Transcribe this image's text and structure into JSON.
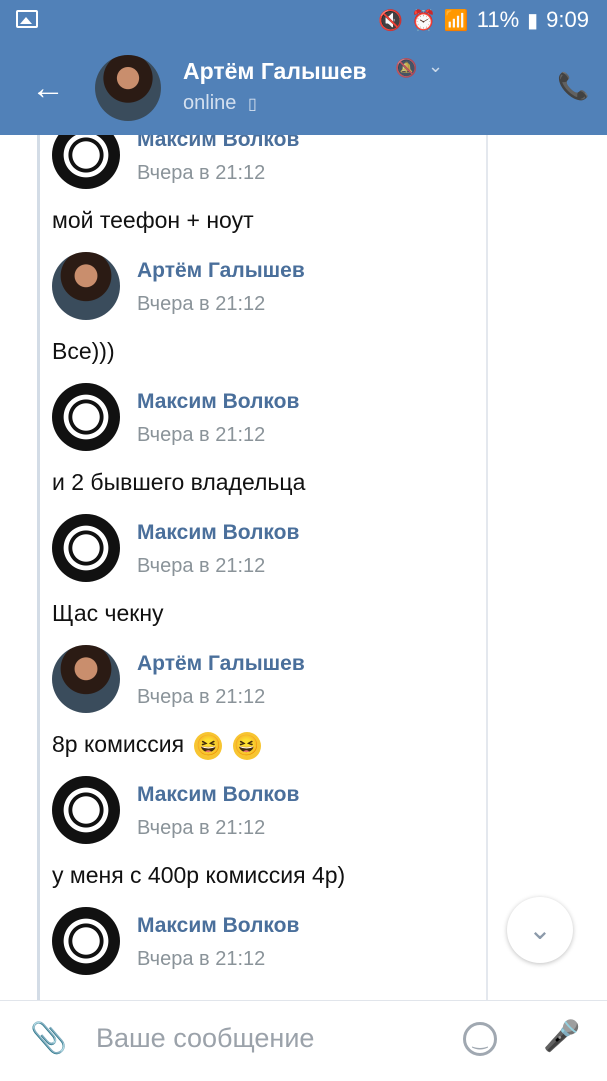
{
  "status_bar": {
    "battery": "11%",
    "time": "9:09"
  },
  "header": {
    "contact_name": "Артём Галышев",
    "presence": "online"
  },
  "messages": [
    {
      "author": "Максим Волков",
      "time": "Вчера в 21:12",
      "text": "мой теефон + ноут",
      "avatar": "maksim"
    },
    {
      "author": "Артём Галышев",
      "time": "Вчера в 21:12",
      "text": "Все)))",
      "avatar": "artem"
    },
    {
      "author": "Максим Волков",
      "time": "Вчера в 21:12",
      "text": "и 2 бывшего владельца",
      "avatar": "maksim"
    },
    {
      "author": "Максим Волков",
      "time": "Вчера в 21:12",
      "text": "Щас чекну",
      "avatar": "maksim"
    },
    {
      "author": "Артём Галышев",
      "time": "Вчера в 21:12",
      "text": "8р комиссия",
      "avatar": "artem"
    },
    {
      "author": "Максим Волков",
      "time": "Вчера в 21:12",
      "text": "у меня с 400р комиссия 4р)",
      "avatar": "maksim"
    },
    {
      "author": "Максим Волков",
      "time": "Вчера в 21:12",
      "text": "",
      "avatar": "maksim"
    }
  ],
  "composer": {
    "placeholder": "Ваше сообщение"
  },
  "icons": {
    "back": "arrow-left-icon",
    "mute": "mute-icon",
    "phone": "phone-icon",
    "attach": "paperclip-icon",
    "emoji": "smiley-icon",
    "mic": "microphone-icon",
    "scroll_down": "chevron-down-icon"
  },
  "colors": {
    "header_bg": "#5181b8",
    "name_text": "#4a6f9b"
  }
}
